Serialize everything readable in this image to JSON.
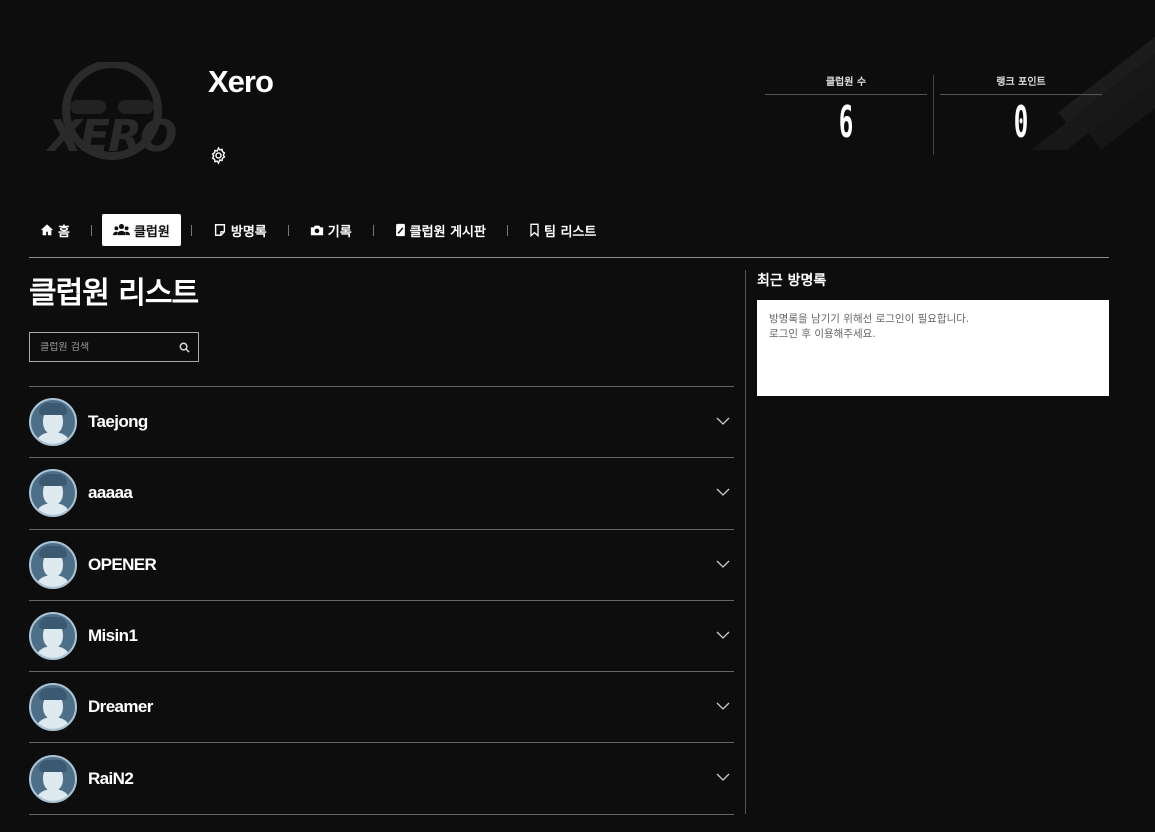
{
  "club": {
    "name": "Xero",
    "logo_text": "XERO"
  },
  "stats": [
    {
      "label": "클럽원 수",
      "value": "6"
    },
    {
      "label": "랭크 포인트",
      "value": "0"
    }
  ],
  "nav": [
    {
      "label": "홈",
      "icon": "home-icon",
      "active": false
    },
    {
      "label": "클럽원",
      "icon": "users-icon",
      "active": true
    },
    {
      "label": "방명록",
      "icon": "note-icon",
      "active": false
    },
    {
      "label": "기록",
      "icon": "camera-icon",
      "active": false
    },
    {
      "label": "클럽원 게시판",
      "icon": "edit-icon",
      "active": false
    },
    {
      "label": "팀 리스트",
      "icon": "bookmark-icon",
      "active": false
    }
  ],
  "main": {
    "title": "클럽원 리스트",
    "search_placeholder": "클럽원 검색",
    "members": [
      "Taejong",
      "aaaaa",
      "OPENER",
      "Misin1",
      "Dreamer",
      "RaiN2"
    ]
  },
  "guestbook": {
    "title": "최근 방명록",
    "line1": "방명록을 남기기 위해선 로그인이 필요합니다.",
    "line2": "로그인 후 이용해주세요."
  }
}
